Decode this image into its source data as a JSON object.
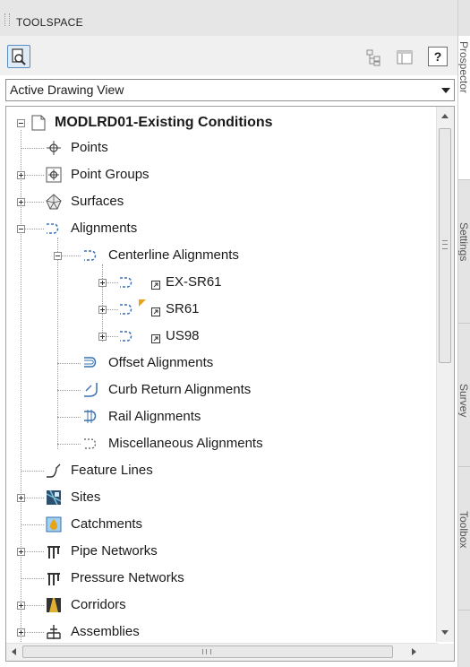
{
  "toolspace": {
    "title": "TOOLSPACE",
    "help_label": "?",
    "view_selector": "Active Drawing View"
  },
  "tree": {
    "root": "MODLRD01-Existing Conditions",
    "items": [
      {
        "label": "Points",
        "icon": "points-icon"
      },
      {
        "label": "Point Groups",
        "icon": "point-groups-icon"
      },
      {
        "label": "Surfaces",
        "icon": "surfaces-icon"
      },
      {
        "label": "Alignments",
        "icon": "alignments-icon"
      },
      {
        "label": "Centerline Alignments",
        "icon": "centerline-alignments-icon"
      },
      {
        "label": "EX-SR61",
        "icon": "alignment-icon"
      },
      {
        "label": "SR61",
        "icon": "alignment-icon"
      },
      {
        "label": "US98",
        "icon": "alignment-icon"
      },
      {
        "label": "Offset Alignments",
        "icon": "offset-alignments-icon"
      },
      {
        "label": "Curb Return Alignments",
        "icon": "curb-return-alignments-icon"
      },
      {
        "label": "Rail Alignments",
        "icon": "rail-alignments-icon"
      },
      {
        "label": "Miscellaneous Alignments",
        "icon": "miscellaneous-alignments-icon"
      },
      {
        "label": "Feature Lines",
        "icon": "feature-lines-icon"
      },
      {
        "label": "Sites",
        "icon": "sites-icon"
      },
      {
        "label": "Catchments",
        "icon": "catchments-icon"
      },
      {
        "label": "Pipe Networks",
        "icon": "pipe-networks-icon"
      },
      {
        "label": "Pressure Networks",
        "icon": "pressure-networks-icon"
      },
      {
        "label": "Corridors",
        "icon": "corridors-icon"
      },
      {
        "label": "Assemblies",
        "icon": "assemblies-icon"
      }
    ]
  },
  "side_tabs": [
    "Prospector",
    "Settings",
    "Survey",
    "Toolbox"
  ],
  "colors": {
    "accent": "#5a8cc4",
    "warning_marker": "#e8a317"
  }
}
